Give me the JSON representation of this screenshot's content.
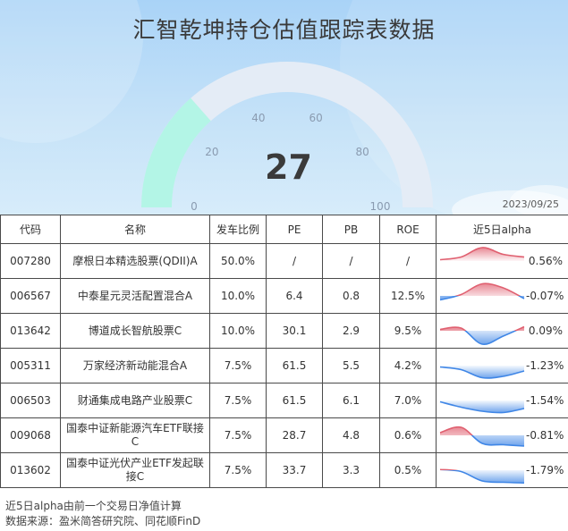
{
  "header": {
    "title": "汇智乾坤持仓估值跟踪表数据",
    "date": "2023/09/25"
  },
  "gauge": {
    "value": 27,
    "value_label": "27",
    "min": 0,
    "max": 100,
    "ticks": [
      "0",
      "20",
      "40",
      "60",
      "80",
      "100"
    ],
    "fill_color": "#b3f5e6",
    "track_color": "#e4ecf6"
  },
  "table": {
    "headers": [
      "代码",
      "名称",
      "发车比例",
      "PE",
      "PB",
      "ROE",
      "近5日alpha"
    ],
    "rows": [
      {
        "code": "007280",
        "name": "摩根日本精选股票(QDII)A",
        "weight": "50.0%",
        "pe": "/",
        "pb": "/",
        "roe": "/",
        "alpha": "0.56%",
        "trend": [
          0.1,
          0.3,
          1.0,
          0.5,
          0.3
        ]
      },
      {
        "code": "006567",
        "name": "中泰星元灵活配置混合A",
        "weight": "10.0%",
        "pe": "6.4",
        "pb": "0.8",
        "roe": "12.5%",
        "alpha": "-0.07%",
        "trend": [
          -0.3,
          0.1,
          0.9,
          0.6,
          -0.2
        ]
      },
      {
        "code": "013642",
        "name": "博道成长智航股票C",
        "weight": "10.0%",
        "pe": "30.1",
        "pb": "2.9",
        "roe": "9.5%",
        "alpha": "0.09%",
        "trend": [
          0.1,
          0.2,
          -1.0,
          -0.4,
          0.3
        ]
      },
      {
        "code": "005311",
        "name": "万家经济新动能混合A",
        "weight": "7.5%",
        "pe": "61.5",
        "pb": "5.5",
        "roe": "4.2%",
        "alpha": "-1.23%",
        "trend": [
          -0.1,
          -0.3,
          -0.9,
          -0.8,
          -0.4
        ]
      },
      {
        "code": "006503",
        "name": "财通集成电路产业股票C",
        "weight": "7.5%",
        "pe": "61.5",
        "pb": "6.1",
        "roe": "7.0%",
        "alpha": "-1.54%",
        "trend": [
          -0.1,
          -0.5,
          -0.8,
          -0.9,
          -0.6
        ]
      },
      {
        "code": "009068",
        "name": "国泰中证新能源汽车ETF联接C",
        "weight": "7.5%",
        "pe": "28.7",
        "pb": "4.8",
        "roe": "0.6%",
        "alpha": "-0.81%",
        "trend": [
          0.2,
          0.6,
          -0.6,
          -0.7,
          -0.8
        ]
      },
      {
        "code": "013602",
        "name": "国泰中证光伏产业ETF发起联接C",
        "weight": "7.5%",
        "pe": "33.7",
        "pb": "3.3",
        "roe": "0.5%",
        "alpha": "-1.79%",
        "trend": [
          0.05,
          -0.1,
          -0.8,
          -0.9,
          -0.95
        ]
      }
    ]
  },
  "colors": {
    "positive": "#e06070",
    "negative": "#3f86e6"
  },
  "footer": {
    "note": "近5日alpha由前一个交易日净值计算",
    "source": "数据来源：盈米简答研究院、同花顺FinD"
  }
}
